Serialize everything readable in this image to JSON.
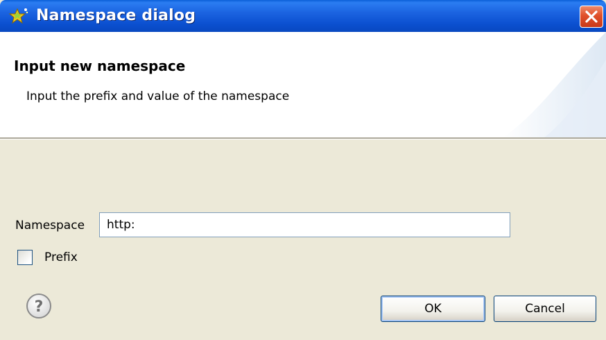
{
  "window": {
    "title": "Namespace dialog",
    "title_icon": "wizard-star-icon",
    "close_icon": "close-icon"
  },
  "header": {
    "title": "Input new namespace",
    "description": "Input the prefix and value of the namespace"
  },
  "form": {
    "namespace_label": "Namespace",
    "namespace_value": "http:",
    "prefix_label": "Prefix",
    "prefix_checked": false
  },
  "footer": {
    "help_icon": "help-icon",
    "ok_label": "OK",
    "cancel_label": "Cancel"
  },
  "colors": {
    "titlebar": "#0b50d0",
    "dialog_bg": "#ece9d8",
    "close_button": "#e0502a",
    "input_border": "#7f9db9"
  }
}
